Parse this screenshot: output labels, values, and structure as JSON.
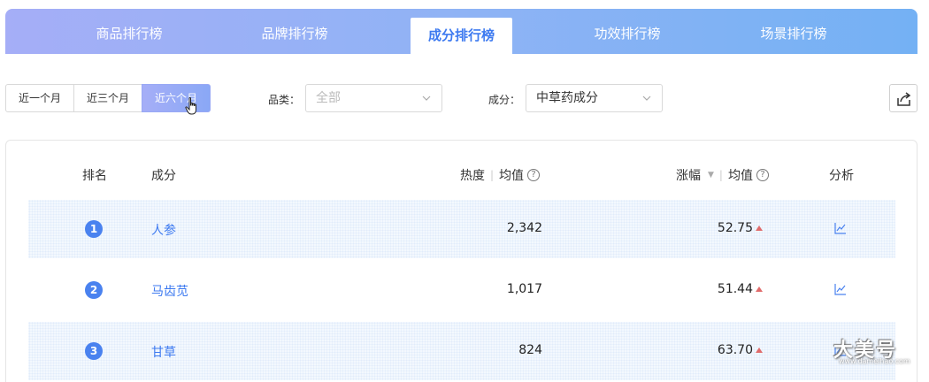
{
  "tabs": [
    {
      "label": "商品排行榜",
      "active": false
    },
    {
      "label": "品牌排行榜",
      "active": false
    },
    {
      "label": "成分排行榜",
      "active": true
    },
    {
      "label": "功效排行榜",
      "active": false
    },
    {
      "label": "场景排行榜",
      "active": false
    }
  ],
  "filters": {
    "periods": [
      "近一个月",
      "近三个月",
      "近六个月"
    ],
    "active_period": "近六个月",
    "category_label": "品类：",
    "category_value": "全部",
    "ingredient_label": "成分：",
    "ingredient_value": "中草药成分"
  },
  "table": {
    "headers": {
      "rank": "排名",
      "ingredient": "成分",
      "heat": "热度",
      "heat_avg": "均值",
      "rise": "涨幅",
      "rise_avg": "均值",
      "analysis": "分析"
    },
    "rows": [
      {
        "rank": "1",
        "name": "人参",
        "heat": "2,342",
        "rise": "52.75"
      },
      {
        "rank": "2",
        "name": "马齿苋",
        "heat": "1,017",
        "rise": "51.44"
      },
      {
        "rank": "3",
        "name": "甘草",
        "heat": "824",
        "rise": "63.70"
      }
    ]
  },
  "watermark": {
    "text": "大美号",
    "sub": "www.dameihao.com"
  },
  "colors": {
    "accent": "#3d7af0",
    "rank_badge": "#4a82ef",
    "up_arrow": "#e06b6b"
  }
}
